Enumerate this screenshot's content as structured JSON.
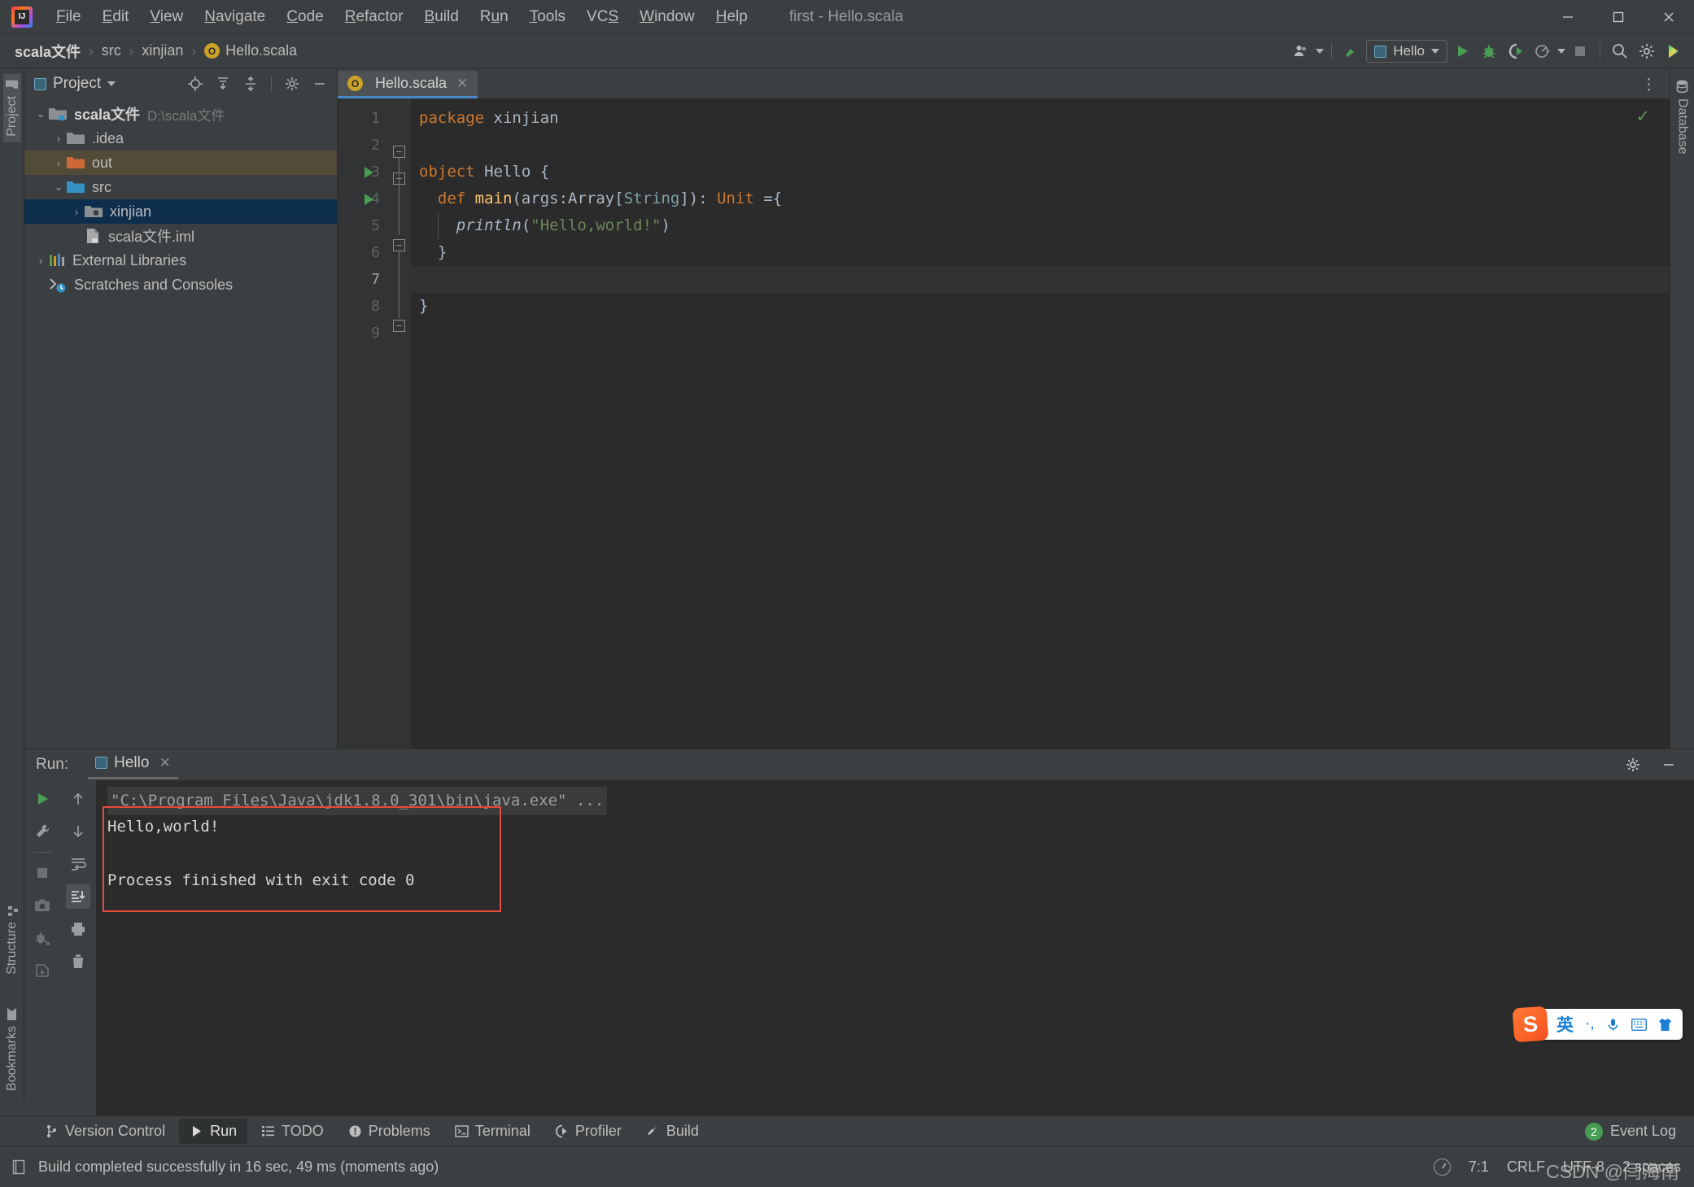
{
  "window": {
    "title": "first - Hello.scala",
    "logo_text": "IJ",
    "minimize": "—",
    "maximize": "▢",
    "close": "✕"
  },
  "menu": [
    {
      "label": "File",
      "mnemonic": "F"
    },
    {
      "label": "Edit",
      "mnemonic": "E"
    },
    {
      "label": "View",
      "mnemonic": "V"
    },
    {
      "label": "Navigate",
      "mnemonic": "N"
    },
    {
      "label": "Code",
      "mnemonic": "C"
    },
    {
      "label": "Refactor",
      "mnemonic": "R"
    },
    {
      "label": "Build",
      "mnemonic": "B"
    },
    {
      "label": "Run",
      "mnemonic": "u"
    },
    {
      "label": "Tools",
      "mnemonic": "T"
    },
    {
      "label": "VCS",
      "mnemonic": "S"
    },
    {
      "label": "Window",
      "mnemonic": "W"
    },
    {
      "label": "Help",
      "mnemonic": "H"
    }
  ],
  "navbar": {
    "breadcrumb": [
      "scala文件",
      "src",
      "xinjian",
      "Hello.scala"
    ],
    "scala_badge": "O",
    "separator": "›",
    "run_config": "Hello",
    "icons": [
      "user-avatar-icon",
      "build-hammer-icon",
      "run-icon",
      "debug-icon",
      "run-with-coverage-icon",
      "profile-icon",
      "stop-icon",
      "search-everywhere-icon",
      "settings-gear-icon",
      "ide-assistant-icon"
    ]
  },
  "left_strip": {
    "top_tab": "Project",
    "tabs": [
      "Structure",
      "Bookmarks"
    ]
  },
  "right_strip": {
    "tab": "Database"
  },
  "project": {
    "title": "Project",
    "header_icons": [
      "locate-icon",
      "expand-all-icon",
      "collapse-all-icon",
      "settings-gear-icon",
      "hide-icon"
    ],
    "tree": [
      {
        "label": "scala文件",
        "path": "D:\\scala文件",
        "arrow": "⌄",
        "icon": "project-folder-icon",
        "depth": 0,
        "state": "normal"
      },
      {
        "label": ".idea",
        "path": "",
        "arrow": "›",
        "icon": "folder-gray-icon",
        "depth": 1,
        "state": "normal"
      },
      {
        "label": "out",
        "path": "",
        "arrow": "›",
        "icon": "folder-orange-icon",
        "depth": 1,
        "state": "selected-out"
      },
      {
        "label": "src",
        "path": "",
        "arrow": "⌄",
        "icon": "folder-blue-icon",
        "depth": 1,
        "state": "normal"
      },
      {
        "label": "xinjian",
        "path": "",
        "arrow": "›",
        "icon": "package-folder-icon",
        "depth": 2,
        "state": "selected"
      },
      {
        "label": "scala文件.iml",
        "path": "",
        "arrow": "",
        "icon": "iml-file-icon",
        "depth": 2,
        "state": "normal"
      },
      {
        "label": "External Libraries",
        "path": "",
        "arrow": "›",
        "icon": "libraries-icon",
        "depth": 0,
        "state": "normal"
      },
      {
        "label": "Scratches and Consoles",
        "path": "",
        "arrow": "",
        "icon": "scratches-icon",
        "depth": 0,
        "state": "normal"
      }
    ]
  },
  "editor": {
    "tab_label": "Hello.scala",
    "tab_badge": "O",
    "tab_close": "✕",
    "options_icon": "⋮",
    "inspection_status": "✓",
    "hint_text": "Hello",
    "line_numbers": [
      "1",
      "2",
      "3",
      "4",
      "5",
      "6",
      "7",
      "8",
      "9"
    ],
    "current_line": 7,
    "gutter_run_lines": [
      3,
      4
    ],
    "code_lines": [
      {
        "n": 1,
        "tokens": [
          {
            "t": "package ",
            "c": "kw"
          },
          {
            "t": "xinjian",
            "c": "id"
          }
        ]
      },
      {
        "n": 2,
        "tokens": []
      },
      {
        "n": 3,
        "tokens": [
          {
            "t": "object ",
            "c": "kw"
          },
          {
            "t": "Hello",
            "c": "id"
          },
          {
            "t": " {",
            "c": "id"
          }
        ]
      },
      {
        "n": 4,
        "tokens": [
          {
            "t": "  ",
            "c": "id"
          },
          {
            "t": "def ",
            "c": "kw"
          },
          {
            "t": "main",
            "c": "fn"
          },
          {
            "t": "(args:Array[",
            "c": "id"
          },
          {
            "t": "String",
            "c": "ty2"
          },
          {
            "t": "]): ",
            "c": "id"
          },
          {
            "t": "Unit ",
            "c": "kw"
          },
          {
            "t": "={",
            "c": "id"
          }
        ]
      },
      {
        "n": 5,
        "tokens": [
          {
            "t": "    ",
            "c": "id"
          },
          {
            "t": "println",
            "c": "it"
          },
          {
            "t": "(",
            "c": "id"
          },
          {
            "t": "\"Hello,world!\"",
            "c": "str"
          },
          {
            "t": ")",
            "c": "id"
          }
        ]
      },
      {
        "n": 6,
        "tokens": [
          {
            "t": "  }",
            "c": "id"
          }
        ]
      },
      {
        "n": 7,
        "tokens": []
      },
      {
        "n": 8,
        "tokens": [
          {
            "t": "}",
            "c": "id"
          }
        ]
      },
      {
        "n": 9,
        "tokens": []
      }
    ]
  },
  "run_panel": {
    "label": "Run:",
    "tab": "Hello",
    "tab_close": "✕",
    "tool_icons": [
      "rerun-icon",
      "edit-configuration-icon",
      "stop-icon",
      "screenshot-icon",
      "dump-threads-icon",
      "export-icon",
      "scroll-up-icon",
      "scroll-down-icon",
      "soft-wrap-icon",
      "scroll-to-end-icon",
      "print-icon",
      "clear-all-icon"
    ],
    "header_icons": [
      "settings-gear-icon",
      "hide-icon"
    ],
    "console": [
      {
        "text": "\"C:\\Program Files\\Java\\jdk1.8.0_301\\bin\\java.exe\" ...",
        "kind": "cmd"
      },
      {
        "text": "Hello,world!",
        "kind": "out"
      },
      {
        "text": "",
        "kind": "out"
      },
      {
        "text": "Process finished with exit code 0",
        "kind": "out"
      }
    ],
    "highlight_box_color": "#e84a3d"
  },
  "bottom_bar": {
    "items": [
      {
        "label": "Version Control",
        "icon": "branch-icon",
        "active": false
      },
      {
        "label": "Run",
        "icon": "run-icon",
        "active": true
      },
      {
        "label": "TODO",
        "icon": "todo-list-icon",
        "active": false
      },
      {
        "label": "Problems",
        "icon": "problems-icon",
        "active": false
      },
      {
        "label": "Terminal",
        "icon": "terminal-icon",
        "active": false
      },
      {
        "label": "Profiler",
        "icon": "profiler-icon",
        "active": false
      },
      {
        "label": "Build",
        "icon": "build-hammer-icon",
        "active": false
      }
    ],
    "event_log": {
      "label": "Event Log",
      "count": "2"
    }
  },
  "status_bar": {
    "message": "Build completed successfully in 16 sec, 49 ms (moments ago)",
    "caret": "7:1",
    "line_separator": "CRLF",
    "encoding": "UTF-8",
    "indent": "2 spaces",
    "lock_icon": "lock-icon"
  },
  "ime": {
    "logo": "S",
    "mode": "英",
    "punctuation": "·,",
    "icons": [
      "microphone-icon",
      "keyboard-icon",
      "skin-icon"
    ]
  },
  "watermark": "CSDN @闫海南",
  "colors": {
    "accent_blue": "#4a88c7",
    "folder_orange": "#cd6839",
    "folder_blue": "#3592c4",
    "run_green": "#499c54",
    "highlight_red": "#e84a3d",
    "selection_blue": "#0d2e4d",
    "selection_tan": "#514b38"
  }
}
